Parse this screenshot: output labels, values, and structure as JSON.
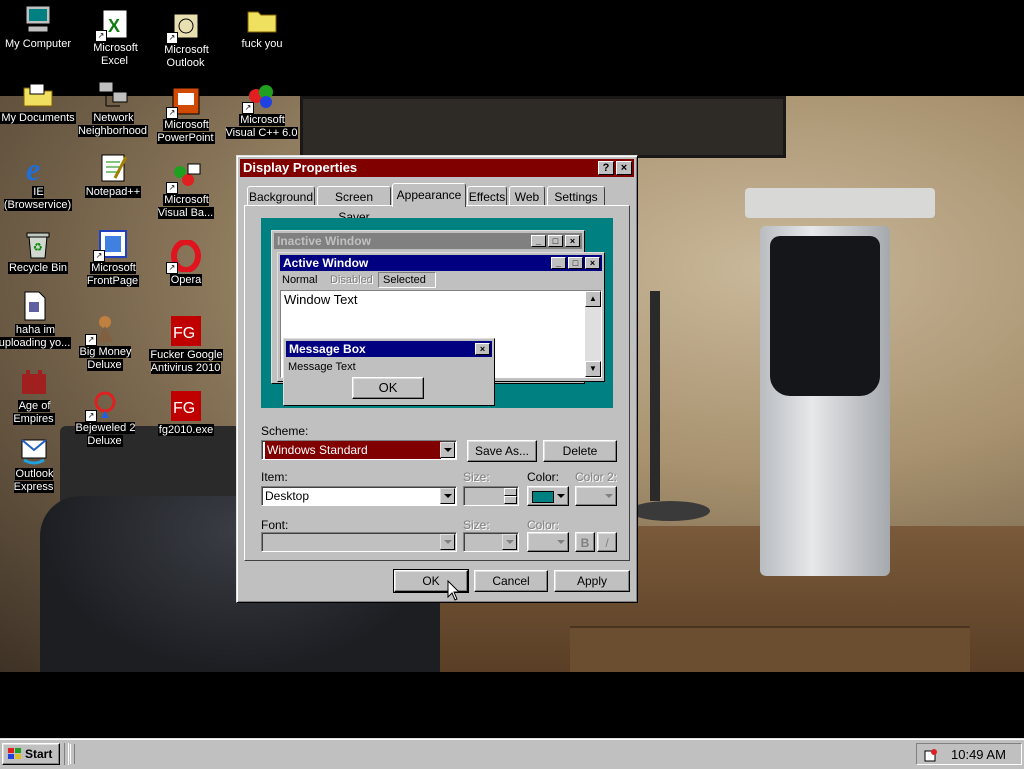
{
  "desktop": {
    "icons": [
      {
        "label": "My Computer",
        "icon": "computer-icon"
      },
      {
        "label": "Microsoft Excel",
        "icon": "excel-icon"
      },
      {
        "label": "Microsoft Outlook",
        "icon": "outlook-icon"
      },
      {
        "label": "fuck you",
        "icon": "folder-icon"
      },
      {
        "label": "My Documents",
        "icon": "documents-folder-icon"
      },
      {
        "label": "Network Neighborhood",
        "icon": "network-icon"
      },
      {
        "label": "Microsoft PowerPoint",
        "icon": "powerpoint-icon"
      },
      {
        "label": "Microsoft Visual C++ 6.0",
        "icon": "visual-cpp-icon"
      },
      {
        "label": "IE (Browservice)",
        "icon": "ie-icon"
      },
      {
        "label": "Notepad++",
        "icon": "notepad-icon"
      },
      {
        "label": "Microsoft Visual Ba...",
        "icon": "visual-basic-icon"
      },
      {
        "label": "Recycle Bin",
        "icon": "recycle-bin-icon"
      },
      {
        "label": "Microsoft FrontPage",
        "icon": "frontpage-icon"
      },
      {
        "label": "Opera",
        "icon": "opera-icon"
      },
      {
        "label": "haha im uploading yo...",
        "icon": "file-icon"
      },
      {
        "label": "Big Money Deluxe",
        "icon": "game-icon"
      },
      {
        "label": "Fucker Google Antivirus 2010",
        "icon": "fg-icon"
      },
      {
        "label": "Age of Empires",
        "icon": "aoe-icon"
      },
      {
        "label": "Bejeweled 2 Deluxe",
        "icon": "bejeweled-icon"
      },
      {
        "label": "fg2010.exe",
        "icon": "fg-exe-icon"
      },
      {
        "label": "Outlook Express",
        "icon": "outlook-express-icon"
      }
    ]
  },
  "dialog": {
    "title": "Display Properties",
    "help_btn": "?",
    "close_btn": "×",
    "tabs": [
      "Background",
      "Screen Saver",
      "Appearance",
      "Effects",
      "Web",
      "Settings"
    ],
    "active_tab": "Appearance",
    "preview": {
      "inactive_title": "Inactive Window",
      "active_title": "Active Window",
      "menu": [
        "Normal",
        "Disabled",
        "Selected"
      ],
      "window_text": "Window Text",
      "msgbox_title": "Message Box",
      "msgbox_text": "Message Text",
      "msgbox_ok": "OK"
    },
    "scheme_label": "Scheme:",
    "scheme_value": "Windows Standard",
    "save_as": "Save As...",
    "delete": "Delete",
    "item_label": "Item:",
    "item_value": "Desktop",
    "size_label": "Size:",
    "color_label": "Color:",
    "color2_label": "Color 2:",
    "font_label": "Font:",
    "font_size_label": "Size:",
    "font_color_label": "Color:",
    "bold": "B",
    "italic": "/",
    "ok": "OK",
    "cancel": "Cancel",
    "apply": "Apply",
    "colors": {
      "title_active": "#800000",
      "desktop_teal": "#008080",
      "scheme_sel": "#800000",
      "preview_active": "#000080",
      "preview_inactive": "#808080"
    }
  },
  "taskbar": {
    "start": "Start",
    "time": "10:49 AM"
  }
}
